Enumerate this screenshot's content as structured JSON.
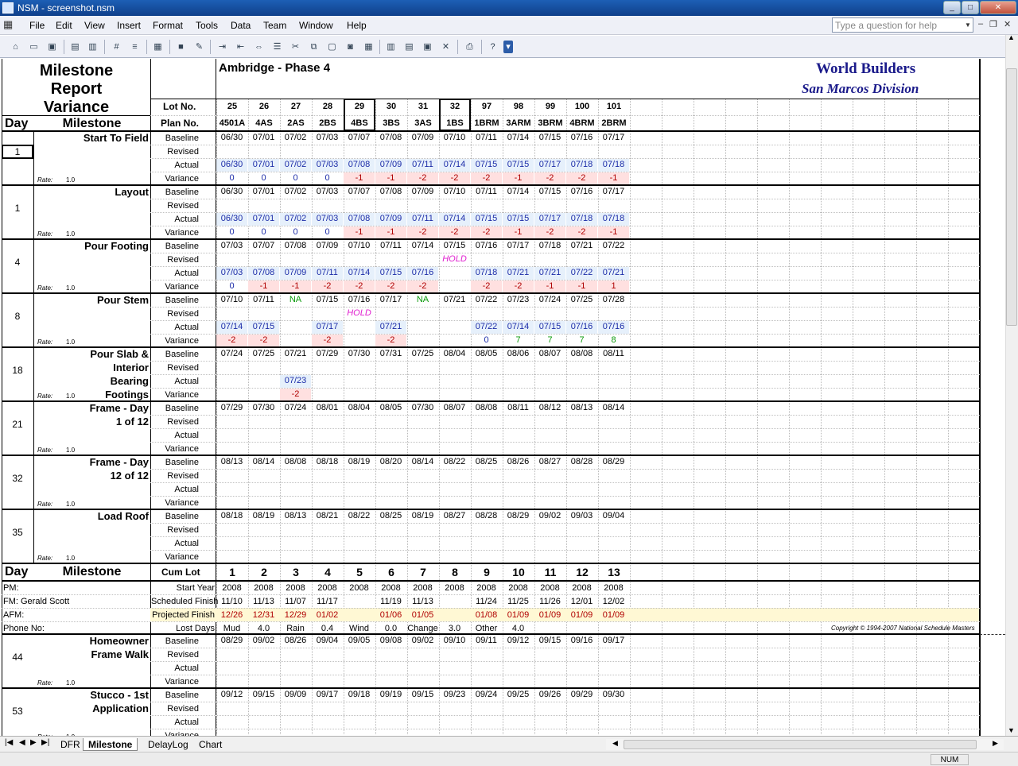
{
  "window": {
    "title": "NSM - screenshot.nsm"
  },
  "menu": {
    "items": [
      "File",
      "Edit",
      "View",
      "Insert",
      "Format",
      "Tools",
      "Data",
      "Team",
      "Window",
      "Help"
    ],
    "help_placeholder": "Type a question for help"
  },
  "report": {
    "title_lines": [
      "Milestone",
      "Report",
      "Variance"
    ],
    "project": "Ambridge - Phase 4",
    "company": "World Builders",
    "division": "San Marcos Division"
  },
  "labels": {
    "lot_no": "Lot No.",
    "plan_no": "Plan No.",
    "day": "Day",
    "milestone": "Milestone",
    "cum_lot": "Cum Lot",
    "rate": "Rate:",
    "rate_value": "1.0",
    "baseline": "Baseline",
    "revised": "Revised",
    "actual": "Actual",
    "variance": "Variance"
  },
  "lots": [
    {
      "lot": "25",
      "plan": "4501A"
    },
    {
      "lot": "26",
      "plan": "4AS"
    },
    {
      "lot": "27",
      "plan": "2AS"
    },
    {
      "lot": "28",
      "plan": "2BS"
    },
    {
      "lot": "29",
      "plan": "4BS"
    },
    {
      "lot": "30",
      "plan": "3BS"
    },
    {
      "lot": "31",
      "plan": "3AS"
    },
    {
      "lot": "32",
      "plan": "1BS"
    },
    {
      "lot": "97",
      "plan": "1BRM"
    },
    {
      "lot": "98",
      "plan": "3ARM"
    },
    {
      "lot": "99",
      "plan": "3BRM"
    },
    {
      "lot": "100",
      "plan": "4BRM"
    },
    {
      "lot": "101",
      "plan": "2BRM"
    }
  ],
  "milestones": [
    {
      "day": "1",
      "name": [
        "Start To Field"
      ],
      "baseline": [
        "06/30",
        "07/01",
        "07/02",
        "07/03",
        "07/07",
        "07/08",
        "07/09",
        "07/10",
        "07/11",
        "07/14",
        "07/15",
        "07/16",
        "07/17"
      ],
      "revised": [
        "",
        "",
        "",
        "",
        "",
        "",
        "",
        "",
        "",
        "",
        "",
        "",
        ""
      ],
      "actual": [
        "06/30",
        "07/01",
        "07/02",
        "07/03",
        "07/08",
        "07/09",
        "07/11",
        "07/14",
        "07/15",
        "07/15",
        "07/17",
        "07/18",
        "07/18"
      ],
      "variance": [
        "0",
        "0",
        "0",
        "0",
        "-1",
        "-1",
        "-2",
        "-2",
        "-2",
        "-1",
        "-2",
        "-2",
        "-1"
      ]
    },
    {
      "day": "1",
      "name": [
        "Layout"
      ],
      "baseline": [
        "06/30",
        "07/01",
        "07/02",
        "07/03",
        "07/07",
        "07/08",
        "07/09",
        "07/10",
        "07/11",
        "07/14",
        "07/15",
        "07/16",
        "07/17"
      ],
      "revised": [
        "",
        "",
        "",
        "",
        "",
        "",
        "",
        "",
        "",
        "",
        "",
        "",
        ""
      ],
      "actual": [
        "06/30",
        "07/01",
        "07/02",
        "07/03",
        "07/08",
        "07/09",
        "07/11",
        "07/14",
        "07/15",
        "07/15",
        "07/17",
        "07/18",
        "07/18"
      ],
      "variance": [
        "0",
        "0",
        "0",
        "0",
        "-1",
        "-1",
        "-2",
        "-2",
        "-2",
        "-1",
        "-2",
        "-2",
        "-1"
      ]
    },
    {
      "day": "4",
      "name": [
        "Pour Footing"
      ],
      "baseline": [
        "07/03",
        "07/07",
        "07/08",
        "07/09",
        "07/10",
        "07/11",
        "07/14",
        "07/15",
        "07/16",
        "07/17",
        "07/18",
        "07/21",
        "07/22"
      ],
      "revised": [
        "",
        "",
        "",
        "",
        "",
        "",
        "",
        "HOLD",
        "",
        "",
        "",
        "",
        ""
      ],
      "actual": [
        "07/03",
        "07/08",
        "07/09",
        "07/11",
        "07/14",
        "07/15",
        "07/16",
        "",
        "07/18",
        "07/21",
        "07/21",
        "07/22",
        "07/21"
      ],
      "variance": [
        "0",
        "-1",
        "-1",
        "-2",
        "-2",
        "-2",
        "-2",
        "",
        "-2",
        "-2",
        "-1",
        "-1",
        "1"
      ]
    },
    {
      "day": "8",
      "name": [
        "Pour Stem"
      ],
      "baseline": [
        "07/10",
        "07/11",
        "NA",
        "07/15",
        "07/16",
        "07/17",
        "NA",
        "07/21",
        "07/22",
        "07/23",
        "07/24",
        "07/25",
        "07/28"
      ],
      "revised": [
        "",
        "",
        "",
        "",
        "HOLD",
        "",
        "",
        "",
        "",
        "",
        "",
        "",
        ""
      ],
      "actual": [
        "07/14",
        "07/15",
        "",
        "07/17",
        "",
        "07/21",
        "",
        "",
        "07/22",
        "07/14",
        "07/15",
        "07/16",
        "07/16"
      ],
      "variance": [
        "-2",
        "-2",
        "",
        "-2",
        "",
        "-2",
        "",
        "",
        "0",
        "7",
        "7",
        "7",
        "8"
      ]
    },
    {
      "day": "18",
      "name": [
        "Pour Slab &",
        "Interior",
        "Bearing",
        "Footings"
      ],
      "baseline": [
        "07/24",
        "07/25",
        "07/21",
        "07/29",
        "07/30",
        "07/31",
        "07/25",
        "08/04",
        "08/05",
        "08/06",
        "08/07",
        "08/08",
        "08/11"
      ],
      "revised": [
        "",
        "",
        "",
        "",
        "",
        "",
        "",
        "",
        "",
        "",
        "",
        "",
        ""
      ],
      "actual": [
        "",
        "",
        "07/23",
        "",
        "",
        "",
        "",
        "",
        "",
        "",
        "",
        "",
        ""
      ],
      "variance": [
        "",
        "",
        "-2",
        "",
        "",
        "",
        "",
        "",
        "",
        "",
        "",
        "",
        ""
      ]
    },
    {
      "day": "21",
      "name": [
        "Frame - Day",
        "1 of 12"
      ],
      "baseline": [
        "07/29",
        "07/30",
        "07/24",
        "08/01",
        "08/04",
        "08/05",
        "07/30",
        "08/07",
        "08/08",
        "08/11",
        "08/12",
        "08/13",
        "08/14"
      ],
      "revised": [
        "",
        "",
        "",
        "",
        "",
        "",
        "",
        "",
        "",
        "",
        "",
        "",
        ""
      ],
      "actual": [
        "",
        "",
        "",
        "",
        "",
        "",
        "",
        "",
        "",
        "",
        "",
        "",
        ""
      ],
      "variance": [
        "",
        "",
        "",
        "",
        "",
        "",
        "",
        "",
        "",
        "",
        "",
        "",
        ""
      ]
    },
    {
      "day": "32",
      "name": [
        "Frame - Day",
        "12 of 12"
      ],
      "baseline": [
        "08/13",
        "08/14",
        "08/08",
        "08/18",
        "08/19",
        "08/20",
        "08/14",
        "08/22",
        "08/25",
        "08/26",
        "08/27",
        "08/28",
        "08/29"
      ],
      "revised": [
        "",
        "",
        "",
        "",
        "",
        "",
        "",
        "",
        "",
        "",
        "",
        "",
        ""
      ],
      "actual": [
        "",
        "",
        "",
        "",
        "",
        "",
        "",
        "",
        "",
        "",
        "",
        "",
        ""
      ],
      "variance": [
        "",
        "",
        "",
        "",
        "",
        "",
        "",
        "",
        "",
        "",
        "",
        "",
        ""
      ]
    },
    {
      "day": "35",
      "name": [
        "Load Roof"
      ],
      "baseline": [
        "08/18",
        "08/19",
        "08/13",
        "08/21",
        "08/22",
        "08/25",
        "08/19",
        "08/27",
        "08/28",
        "08/29",
        "09/02",
        "09/03",
        "09/04"
      ],
      "revised": [
        "",
        "",
        "",
        "",
        "",
        "",
        "",
        "",
        "",
        "",
        "",
        "",
        ""
      ],
      "actual": [
        "",
        "",
        "",
        "",
        "",
        "",
        "",
        "",
        "",
        "",
        "",
        "",
        ""
      ],
      "variance": [
        "",
        "",
        "",
        "",
        "",
        "",
        "",
        "",
        "",
        "",
        "",
        "",
        ""
      ]
    }
  ],
  "summary": {
    "cum_lots": [
      "1",
      "2",
      "3",
      "4",
      "5",
      "6",
      "7",
      "8",
      "9",
      "10",
      "11",
      "12",
      "13"
    ],
    "rows": [
      {
        "left": "PM:",
        "label": "Start Year",
        "values": [
          "2008",
          "2008",
          "2008",
          "2008",
          "2008",
          "2008",
          "2008",
          "2008",
          "2008",
          "2008",
          "2008",
          "2008",
          "2008"
        ]
      },
      {
        "left": "FM: Gerald Scott",
        "label": "Scheduled Finish",
        "values": [
          "11/10",
          "11/13",
          "11/07",
          "11/17",
          "",
          "11/19",
          "11/13",
          "",
          "11/24",
          "11/25",
          "11/26",
          "12/01",
          "12/02"
        ]
      },
      {
        "left": "AFM:",
        "label": "Projected Finish",
        "values": [
          "12/26",
          "12/31",
          "12/29",
          "01/02",
          "",
          "01/06",
          "01/05",
          "",
          "01/08",
          "01/09",
          "01/09",
          "01/09",
          "01/09"
        ]
      },
      {
        "left": "Phone No:",
        "label": "Lost Days",
        "values": [
          "Mud",
          "4.0",
          "Rain",
          "0.4",
          "Wind",
          "0.0",
          "Change",
          "3.0",
          "Other",
          "4.0",
          "",
          "",
          ""
        ]
      }
    ],
    "copyright": "Copyright © 1994-2007 National Schedule Masters"
  },
  "lower_milestones": [
    {
      "day": "44",
      "name": [
        "Homeowner",
        "Frame Walk"
      ],
      "baseline": [
        "08/29",
        "09/02",
        "08/26",
        "09/04",
        "09/05",
        "09/08",
        "09/02",
        "09/10",
        "09/11",
        "09/12",
        "09/15",
        "09/16",
        "09/17"
      ]
    },
    {
      "day": "53",
      "name": [
        "Stucco - 1st",
        "Application"
      ],
      "baseline": [
        "09/12",
        "09/15",
        "09/09",
        "09/17",
        "09/18",
        "09/19",
        "09/15",
        "09/23",
        "09/24",
        "09/25",
        "09/26",
        "09/29",
        "09/30"
      ]
    }
  ],
  "selected_cell": "1",
  "tabs": [
    "DFR",
    "Milestone",
    "DelayLog",
    "Chart"
  ],
  "active_tab": "Milestone",
  "status": {
    "num": "NUM"
  }
}
